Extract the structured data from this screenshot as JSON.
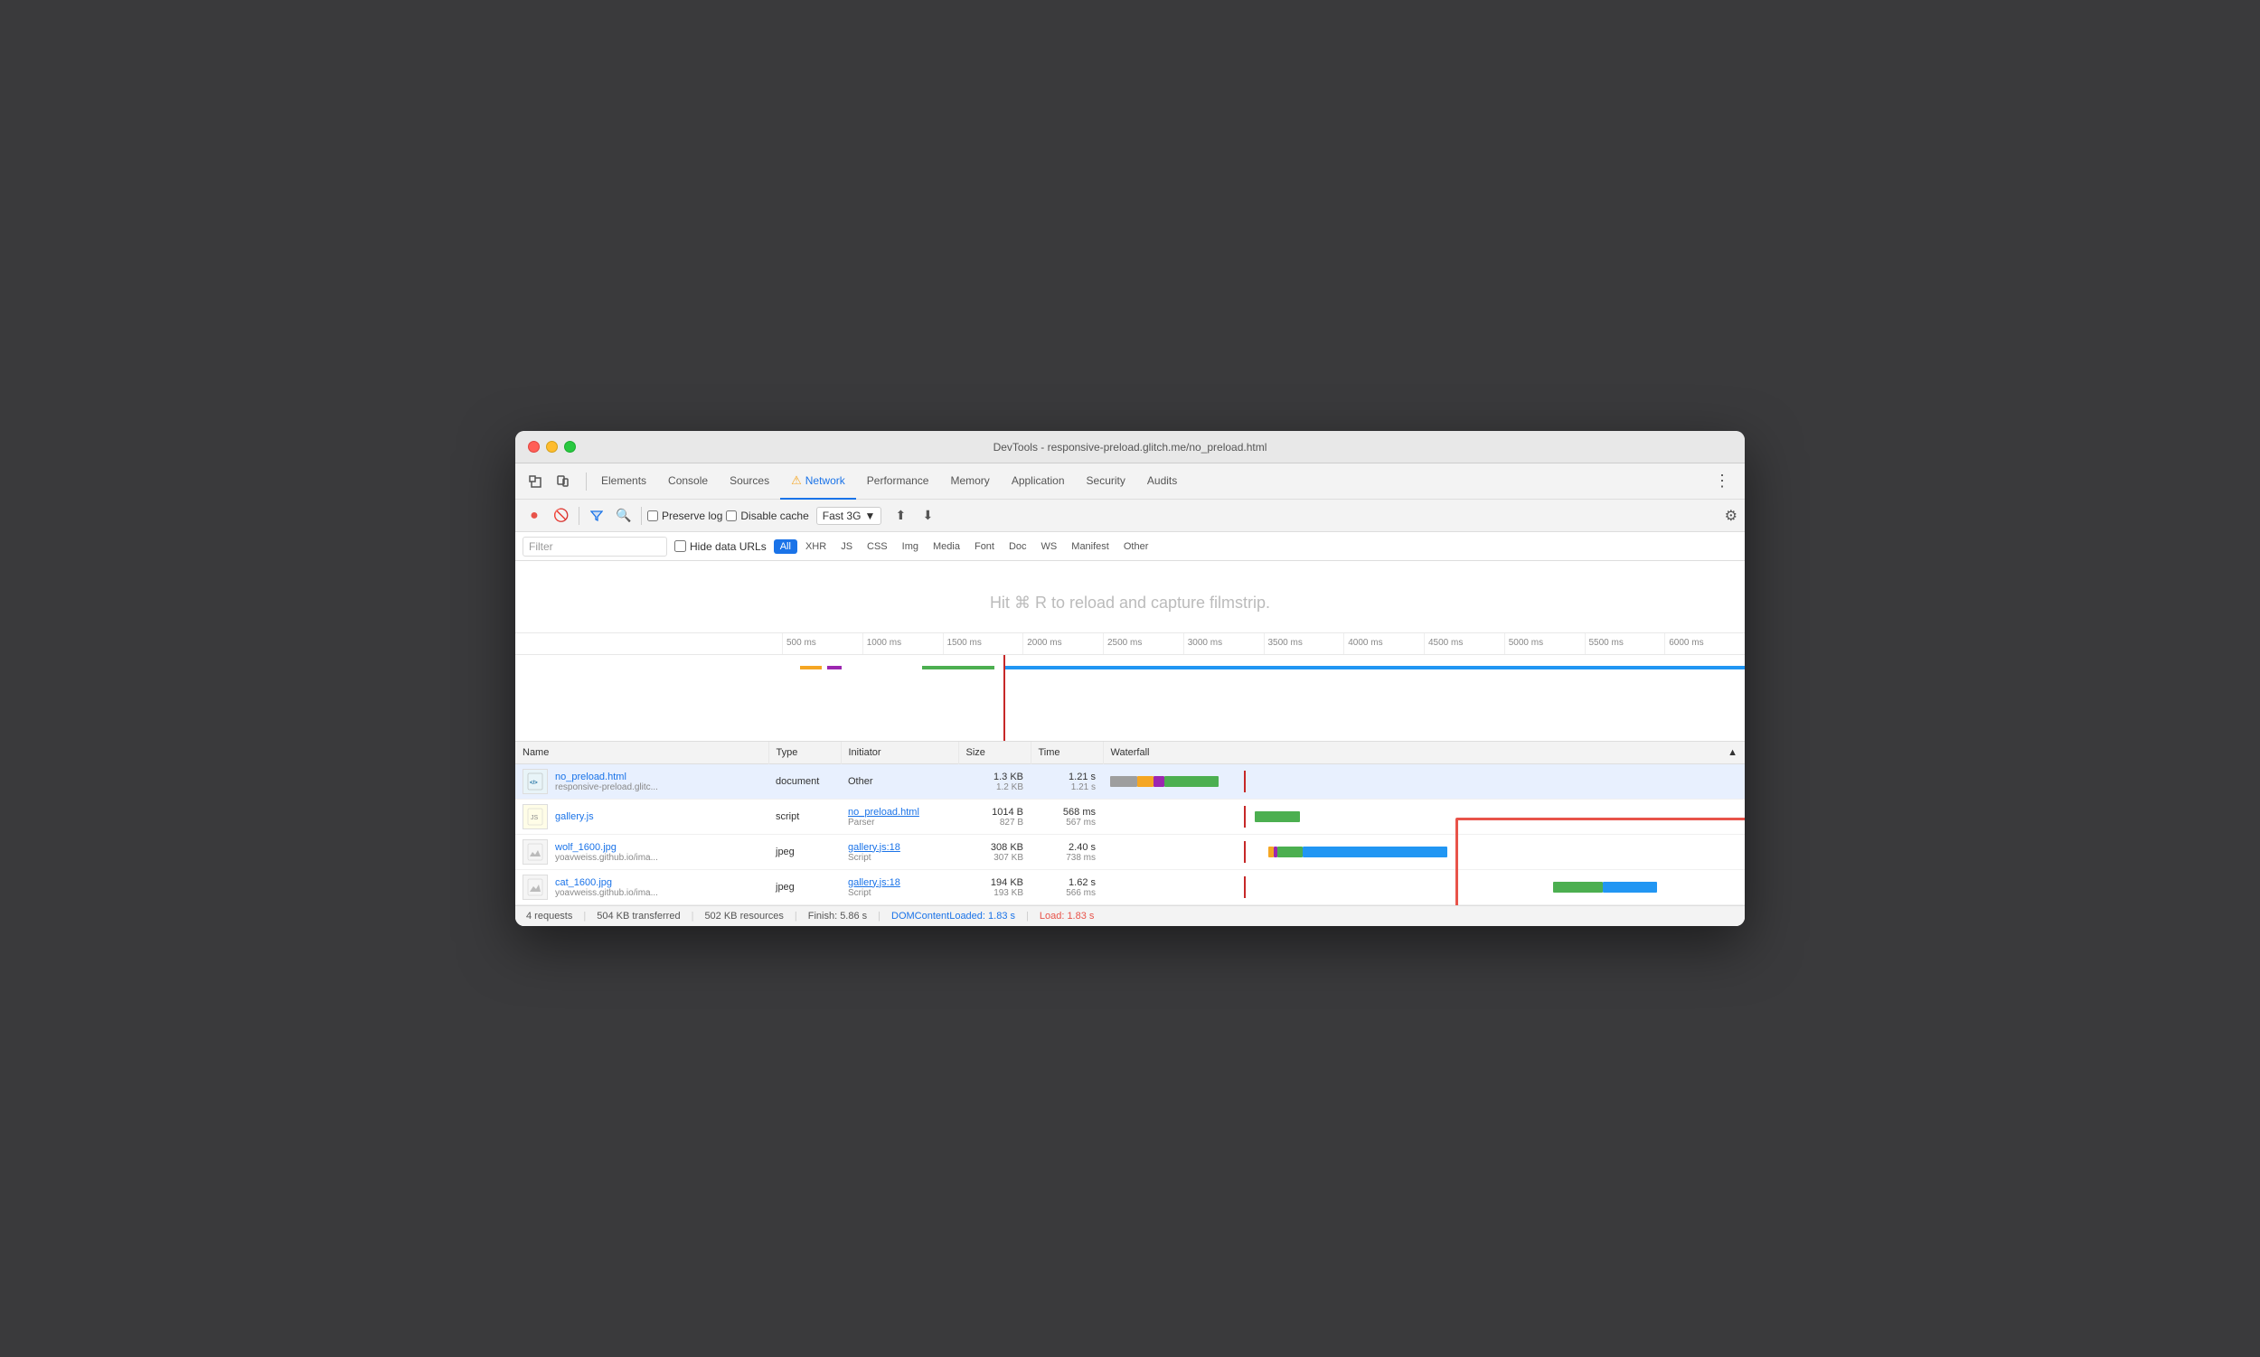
{
  "window": {
    "title": "DevTools - responsive-preload.glitch.me/no_preload.html"
  },
  "nav": {
    "tabs": [
      {
        "id": "elements",
        "label": "Elements",
        "active": false
      },
      {
        "id": "console",
        "label": "Console",
        "active": false
      },
      {
        "id": "sources",
        "label": "Sources",
        "active": false
      },
      {
        "id": "network",
        "label": "Network",
        "active": true,
        "warning": true
      },
      {
        "id": "performance",
        "label": "Performance",
        "active": false
      },
      {
        "id": "memory",
        "label": "Memory",
        "active": false
      },
      {
        "id": "application",
        "label": "Application",
        "active": false
      },
      {
        "id": "security",
        "label": "Security",
        "active": false
      },
      {
        "id": "audits",
        "label": "Audits",
        "active": false
      }
    ]
  },
  "toolbar": {
    "preserve_log_label": "Preserve log",
    "disable_cache_label": "Disable cache",
    "throttle_label": "Fast 3G"
  },
  "filter": {
    "placeholder": "Filter",
    "hide_data_urls_label": "Hide data URLs",
    "types": [
      {
        "id": "all",
        "label": "All",
        "active": true
      },
      {
        "id": "xhr",
        "label": "XHR",
        "active": false
      },
      {
        "id": "js",
        "label": "JS",
        "active": false
      },
      {
        "id": "css",
        "label": "CSS",
        "active": false
      },
      {
        "id": "img",
        "label": "Img",
        "active": false
      },
      {
        "id": "media",
        "label": "Media",
        "active": false
      },
      {
        "id": "font",
        "label": "Font",
        "active": false
      },
      {
        "id": "doc",
        "label": "Doc",
        "active": false
      },
      {
        "id": "ws",
        "label": "WS",
        "active": false
      },
      {
        "id": "manifest",
        "label": "Manifest",
        "active": false
      },
      {
        "id": "other",
        "label": "Other",
        "active": false
      }
    ]
  },
  "filmstrip": {
    "hint": "Hit ⌘ R to reload and capture filmstrip."
  },
  "timeline": {
    "ticks": [
      "500 ms",
      "1000 ms",
      "1500 ms",
      "2000 ms",
      "2500 ms",
      "3000 ms",
      "3500 ms",
      "4000 ms",
      "4500 ms",
      "5000 ms",
      "5500 ms",
      "6000 ms"
    ]
  },
  "table": {
    "columns": [
      "Name",
      "Type",
      "Initiator",
      "Size",
      "Time",
      "Waterfall"
    ],
    "rows": [
      {
        "id": "row1",
        "name": "no_preload.html",
        "url": "responsive-preload.glitc...",
        "icon_type": "html",
        "type": "document",
        "initiator": "Other",
        "initiator_link": false,
        "size_main": "1.3 KB",
        "size_sub": "1.2 KB",
        "time_main": "1.21 s",
        "time_sub": "1.21 s",
        "selected": true
      },
      {
        "id": "row2",
        "name": "gallery.js",
        "url": "",
        "icon_type": "js",
        "type": "script",
        "initiator": "no_preload.html",
        "initiator_sub": "Parser",
        "initiator_link": true,
        "size_main": "1014 B",
        "size_sub": "827 B",
        "time_main": "568 ms",
        "time_sub": "567 ms",
        "selected": false
      },
      {
        "id": "row3",
        "name": "wolf_1600.jpg",
        "url": "yoavweiss.github.io/ima...",
        "icon_type": "img",
        "type": "jpeg",
        "initiator": "gallery.js:18",
        "initiator_sub": "Script",
        "initiator_link": true,
        "size_main": "308 KB",
        "size_sub": "307 KB",
        "time_main": "2.40 s",
        "time_sub": "738 ms",
        "selected": false
      },
      {
        "id": "row4",
        "name": "cat_1600.jpg",
        "url": "yoavweiss.github.io/ima...",
        "icon_type": "img",
        "type": "jpeg",
        "initiator": "gallery.js:18",
        "initiator_sub": "Script",
        "initiator_link": true,
        "size_main": "194 KB",
        "size_sub": "193 KB",
        "time_main": "1.62 s",
        "time_sub": "566 ms",
        "selected": false
      }
    ]
  },
  "status_bar": {
    "requests": "4 requests",
    "transferred": "504 KB transferred",
    "resources": "502 KB resources",
    "finish": "Finish: 5.86 s",
    "dom_loaded": "DOMContentLoaded: 1.83 s",
    "load": "Load: 1.83 s"
  }
}
